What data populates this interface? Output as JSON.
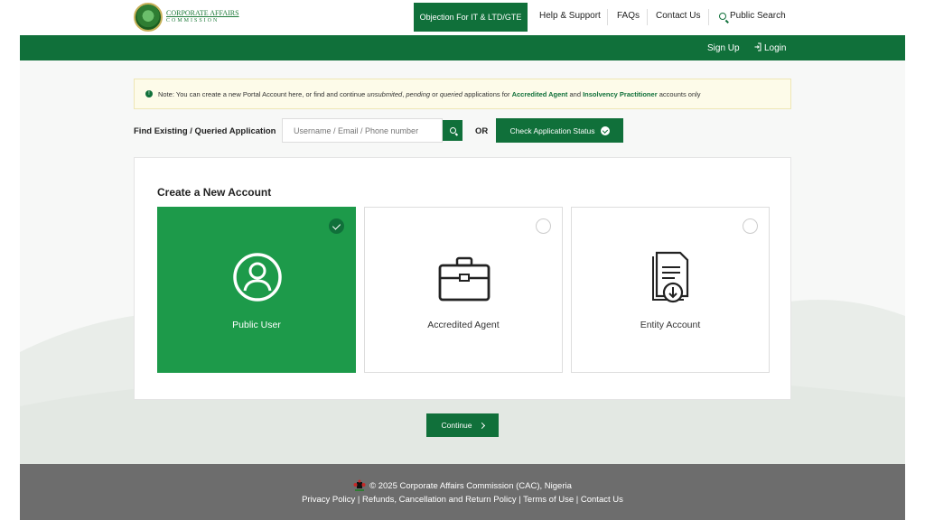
{
  "brand": {
    "line1": "CORPORATE AFFAIRS",
    "line2": "COMMISSION"
  },
  "nav": {
    "objection": "Objection For IT & LTD/GTE",
    "help": "Help & Support",
    "faqs": "FAQs",
    "contact": "Contact Us",
    "public_search": "Public Search",
    "signup": "Sign Up",
    "login": "Login"
  },
  "notice": {
    "prefix": "Note: You can create a new Portal Account here, or find and continue ",
    "unsubmitted": "unsubmited",
    "comma": ", ",
    "pending": "pending",
    "or": " or ",
    "queried": "queried",
    "middle": " applications for ",
    "agent": "Accredited Agent",
    "and": " and ",
    "insolvency": "Insolvency Practitioner",
    "suffix": " accounts only"
  },
  "find": {
    "label": "Find Existing / Queried Application",
    "placeholder": "Username / Email / Phone number",
    "or_label": "OR",
    "status_button": "Check Application Status"
  },
  "create": {
    "title": "Create a New Account",
    "options": [
      {
        "label": "Public User",
        "icon": "user-circle-icon",
        "selected": true
      },
      {
        "label": "Accredited Agent",
        "icon": "briefcase-icon",
        "selected": false
      },
      {
        "label": "Entity Account",
        "icon": "document-download-icon",
        "selected": false
      }
    ],
    "continue": "Continue"
  },
  "footer": {
    "copyright": "© 2025 Corporate Affairs Commission (CAC), Nigeria",
    "links": [
      "Privacy Policy",
      "Refunds, Cancellation and Return Policy",
      "Terms of Use",
      "Contact Us"
    ],
    "separator": " | "
  },
  "colors": {
    "brand_green": "#10703a",
    "selected_card": "#1d9a4a",
    "footer_gray": "#6d6d6d",
    "notice_bg": "#fdfbe9"
  }
}
